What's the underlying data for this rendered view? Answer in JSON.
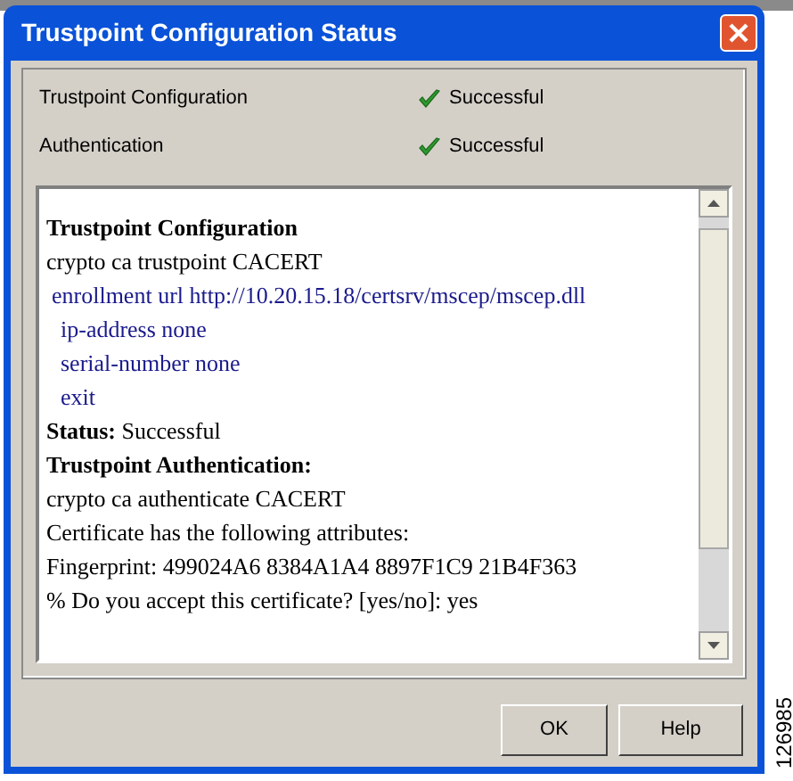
{
  "window": {
    "title": "Trustpoint Configuration Status"
  },
  "status_rows": [
    {
      "label": "Trustpoint Configuration",
      "status": "Successful"
    },
    {
      "label": "Authentication",
      "status": "Successful"
    }
  ],
  "log_lines": [
    {
      "kind": "heading",
      "text": "Trustpoint Configuration"
    },
    {
      "kind": "plain",
      "text": "crypto ca trustpoint CACERT"
    },
    {
      "kind": "config",
      "text": "enrollment url http://10.20.15.18/certsrv/mscep/mscep.dll"
    },
    {
      "kind": "subconfig",
      "text": "ip-address none"
    },
    {
      "kind": "subconfig",
      "text": "serial-number none"
    },
    {
      "kind": "subconfig",
      "text": "exit"
    },
    {
      "kind": "plain",
      "text": "**Status:** Successful"
    },
    {
      "kind": "heading",
      "text": "Trustpoint Authentication:"
    },
    {
      "kind": "plain",
      "text": "crypto ca authenticate CACERT"
    },
    {
      "kind": "plain",
      "text": "Certificate has the following attributes:"
    },
    {
      "kind": "plain",
      "text": "Fingerprint: 499024A6 8384A1A4 8897F1C9 21B4F363"
    },
    {
      "kind": "plain",
      "text": "% Do you accept this certificate? [yes/no]: yes"
    }
  ],
  "buttons": [
    "OK",
    "Help"
  ],
  "figure_number": "126985"
}
